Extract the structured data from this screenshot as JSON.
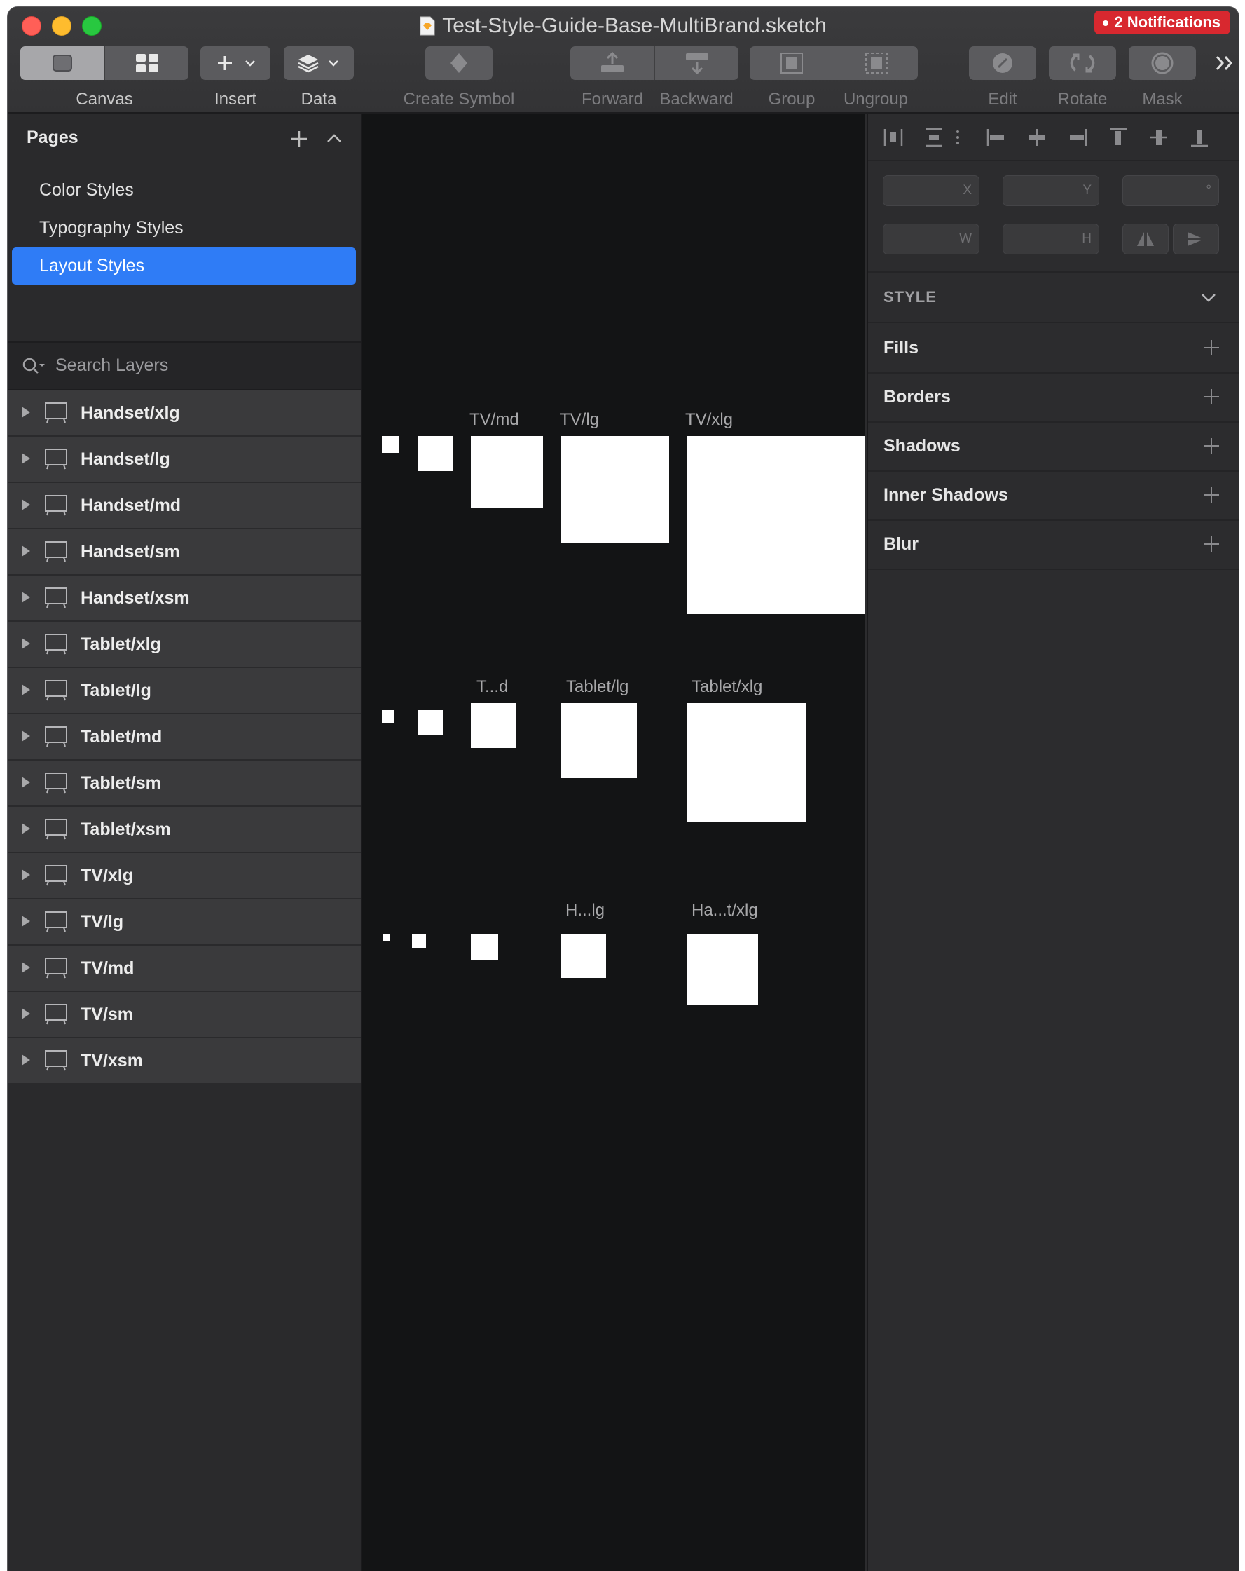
{
  "window": {
    "title": "Test-Style-Guide-Base-MultiBrand.sketch",
    "notifications": "2 Notifications"
  },
  "toolbar": {
    "canvas_label": "Canvas",
    "insert_label": "Insert",
    "data_label": "Data",
    "create_symbol_label": "Create Symbol",
    "forward_label": "Forward",
    "backward_label": "Backward",
    "group_label": "Group",
    "ungroup_label": "Ungroup",
    "edit_label": "Edit",
    "rotate_label": "Rotate",
    "mask_label": "Mask"
  },
  "pages": {
    "title": "Pages",
    "items": [
      {
        "label": "Color Styles"
      },
      {
        "label": "Typography Styles"
      },
      {
        "label": "Layout Styles",
        "selected": true
      }
    ]
  },
  "layers": {
    "search_placeholder": "Search Layers",
    "items": [
      {
        "label": "Handset/xlg"
      },
      {
        "label": "Handset/lg"
      },
      {
        "label": "Handset/md"
      },
      {
        "label": "Handset/sm"
      },
      {
        "label": "Handset/xsm"
      },
      {
        "label": "Tablet/xlg"
      },
      {
        "label": "Tablet/lg"
      },
      {
        "label": "Tablet/md"
      },
      {
        "label": "Tablet/sm"
      },
      {
        "label": "Tablet/xsm"
      },
      {
        "label": "TV/xlg"
      },
      {
        "label": "TV/lg"
      },
      {
        "label": "TV/md"
      },
      {
        "label": "TV/sm"
      },
      {
        "label": "TV/xsm"
      }
    ]
  },
  "canvas": {
    "labels": {
      "tv_md": "TV/md",
      "tv_lg": "TV/lg",
      "tv_xlg": "TV/xlg",
      "tablet_md": "T...d",
      "tablet_lg": "Tablet/lg",
      "tablet_xlg": "Tablet/xlg",
      "handset_lg": "H...lg",
      "handset_xlg": "Ha...t/xlg"
    }
  },
  "inspector": {
    "x_suffix": "X",
    "y_suffix": "Y",
    "rotation_suffix": "°",
    "w_suffix": "W",
    "h_suffix": "H",
    "style_title": "STYLE",
    "style_rows": [
      {
        "label": "Fills"
      },
      {
        "label": "Borders"
      },
      {
        "label": "Shadows"
      },
      {
        "label": "Inner Shadows"
      },
      {
        "label": "Blur"
      }
    ]
  },
  "colors": {
    "accent": "#2f7cf6",
    "notification": "#d8282f",
    "canvas_bg": "#131415",
    "panel_bg": "#2c2c2e"
  }
}
